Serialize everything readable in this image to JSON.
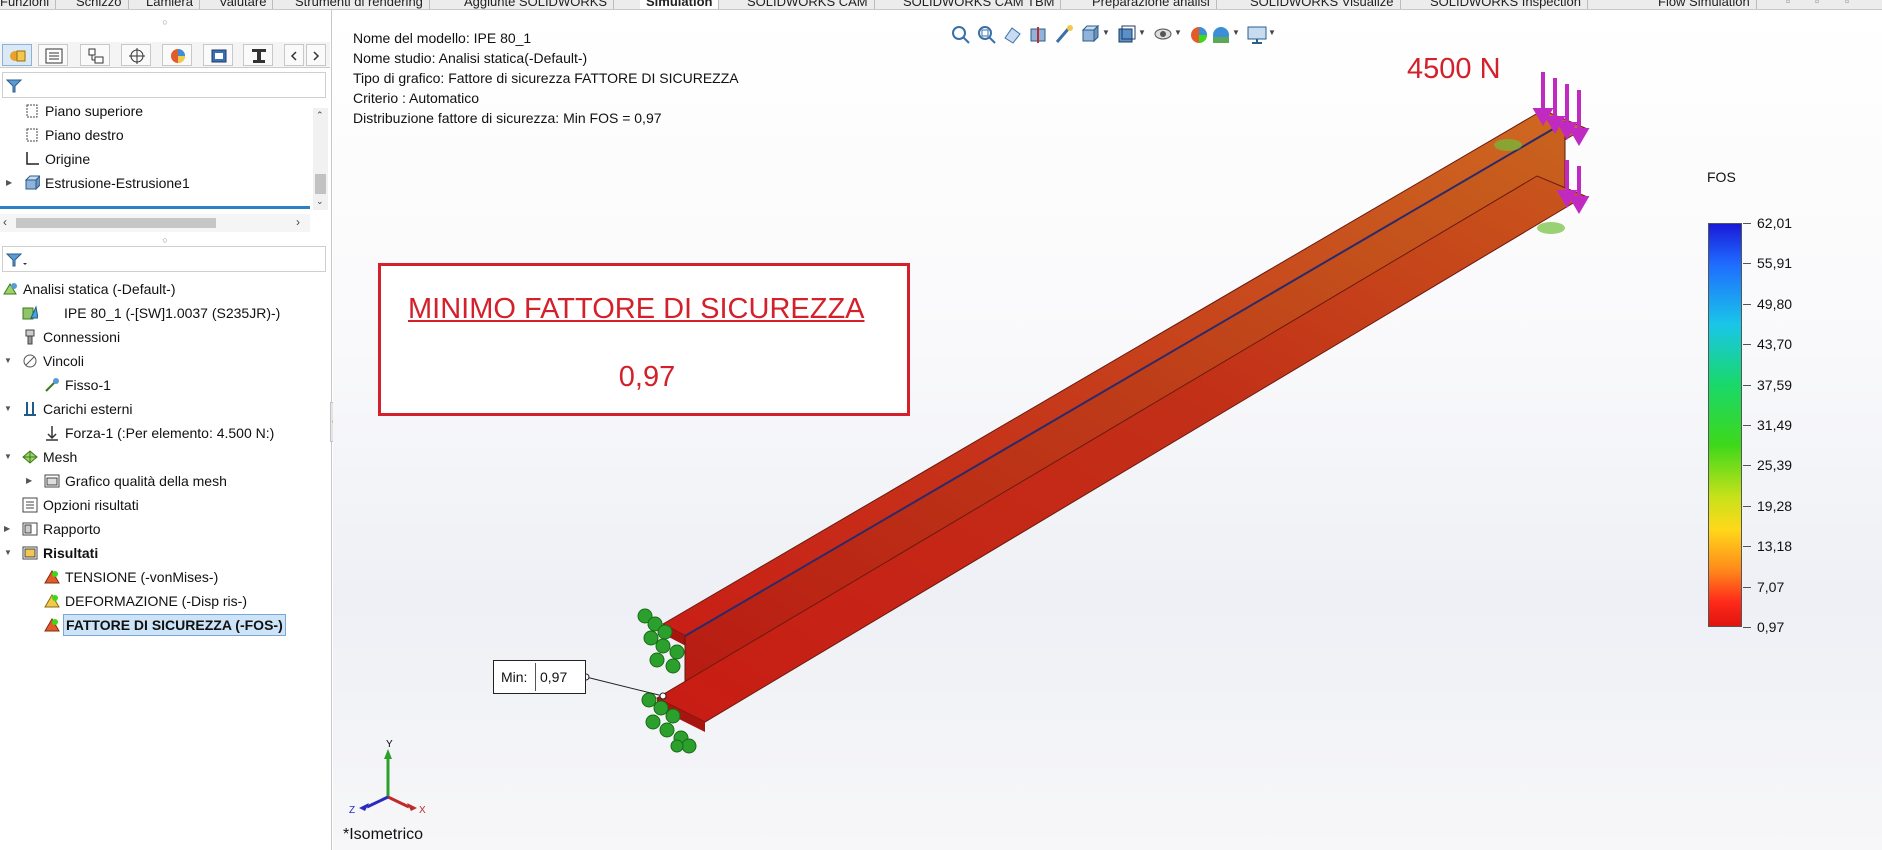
{
  "tabs": [
    {
      "label": "Funzioni",
      "active": false
    },
    {
      "label": "Schizzo",
      "active": false
    },
    {
      "label": "Lamiera",
      "active": false
    },
    {
      "label": "Valutare",
      "active": false
    },
    {
      "label": "Strumenti di rendering",
      "active": false
    },
    {
      "label": "Aggiunte SOLIDWORKS",
      "active": false
    },
    {
      "label": "Simulation",
      "active": true
    },
    {
      "label": "SOLIDWORKS CAM",
      "active": false
    },
    {
      "label": "SOLIDWORKS CAM TBM",
      "active": false
    },
    {
      "label": "Preparazione analisi",
      "active": false
    },
    {
      "label": "SOLIDWORKS Visualize",
      "active": false
    },
    {
      "label": "SOLIDWORKS Inspection",
      "active": false
    },
    {
      "label": "Flow Simulation",
      "active": false
    }
  ],
  "feature_tree": {
    "items": [
      {
        "label": "Piano superiore"
      },
      {
        "label": "Piano destro"
      },
      {
        "label": "Origine"
      },
      {
        "label": "Estrusione-Estrusione1"
      }
    ]
  },
  "study_tree": {
    "items": [
      {
        "label": "Analisi statica (-Default-)"
      },
      {
        "label": "IPE 80_1 (-[SW]1.0037 (S235JR)-)"
      },
      {
        "label": "Connessioni"
      },
      {
        "label": "Vincoli"
      },
      {
        "label": "Fisso-1"
      },
      {
        "label": "Carichi esterni"
      },
      {
        "label": "Forza-1 (:Per elemento: 4.500 N:)"
      },
      {
        "label": "Mesh"
      },
      {
        "label": "Grafico qualità della mesh"
      },
      {
        "label": "Opzioni risultati"
      },
      {
        "label": "Rapporto"
      },
      {
        "label": "Risultati"
      },
      {
        "label": "TENSIONE (-vonMises-)"
      },
      {
        "label": "DEFORMAZIONE (-Disp ris-)"
      },
      {
        "label": "FATTORE DI SICUREZZA (-FOS-)"
      }
    ]
  },
  "viewport": {
    "info": [
      "Nome del modello: IPE 80_1",
      "Nome studio: Analisi statica(-Default-)",
      "Tipo di grafico: Fattore di sicurezza FATTORE DI SICUREZZA",
      "Criterio : Automatico",
      "Distribuzione fattore di sicurezza: Min FOS = 0,97"
    ],
    "annotation_title": "MINIMO FATTORE DI SICUREZZA",
    "annotation_value": "0,97",
    "load_label": "4500 N",
    "min_probe_key": "Min:",
    "min_probe_value": "0,97",
    "view_name": "*Isometrico",
    "triad": {
      "y": "Y",
      "x": "X",
      "z": "Z"
    }
  },
  "legend": {
    "title": "FOS",
    "labels": [
      "62,01",
      "55,91",
      "49,80",
      "43,70",
      "37,59",
      "31,49",
      "25,39",
      "19,28",
      "13,18",
      "7,07",
      "0,97"
    ]
  },
  "colors": {
    "annotation_red": "#d4202a",
    "beam_red": "#c8231a",
    "fixture_green": "#2ca02c",
    "load_magenta": "#c02ac0",
    "selection_blue": "#cde3f7"
  }
}
